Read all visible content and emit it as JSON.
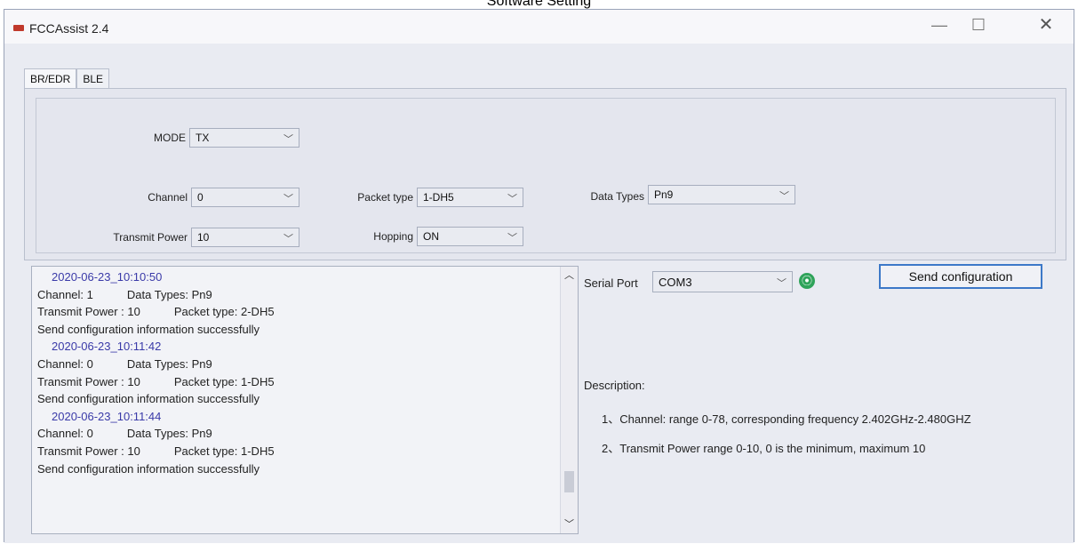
{
  "caption": "Software Setting",
  "window": {
    "title": "FCCAssist 2.4",
    "controls": {
      "minimize": "—",
      "maximize": "☐",
      "close": "✕"
    }
  },
  "tabs": [
    {
      "label": "BR/EDR",
      "active": true
    },
    {
      "label": "BLE",
      "active": false
    }
  ],
  "form": {
    "mode": {
      "label": "MODE",
      "value": "TX"
    },
    "channel": {
      "label": "Channel",
      "value": "0"
    },
    "packet_type": {
      "label": "Packet type",
      "value": "1-DH5"
    },
    "data_types": {
      "label": "Data Types",
      "value": "Pn9"
    },
    "transmit_power": {
      "label": "Transmit Power",
      "value": "10"
    },
    "hopping": {
      "label": "Hopping",
      "value": "ON"
    }
  },
  "log": {
    "lines": [
      {
        "kind": "ts",
        "text": "2020-06-23_10:10:50"
      },
      {
        "kind": "pair",
        "a": "Channel: 1",
        "b": "Data Types: Pn9"
      },
      {
        "kind": "pair",
        "a": "Transmit Power : 10",
        "b": "Packet type: 2-DH5"
      },
      {
        "kind": "text",
        "text": "Send configuration information successfully"
      },
      {
        "kind": "ts",
        "text": "2020-06-23_10:11:42"
      },
      {
        "kind": "pair",
        "a": "Channel: 0",
        "b": "Data Types: Pn9"
      },
      {
        "kind": "pair",
        "a": "Transmit Power : 10",
        "b": "Packet type: 1-DH5"
      },
      {
        "kind": "text",
        "text": "Send configuration information successfully"
      },
      {
        "kind": "ts",
        "text": "2020-06-23_10:11:44"
      },
      {
        "kind": "pair",
        "a": "Channel: 0",
        "b": "Data Types: Pn9"
      },
      {
        "kind": "pair",
        "a": "Transmit Power : 10",
        "b": "Packet type: 1-DH5"
      },
      {
        "kind": "text",
        "text": "Send configuration information successfully"
      }
    ]
  },
  "serial": {
    "label": "Serial Port",
    "value": "COM3"
  },
  "send_button": "Send configuration",
  "description": {
    "title": "Description:",
    "items": [
      "1、Channel: range 0-78, corresponding frequency 2.402GHz-2.480GHZ",
      "2、Transmit Power  range 0-10, 0 is the minimum, maximum 10"
    ]
  },
  "colors": {
    "accent": "#3c78c8",
    "timestamp": "#3a3aa8",
    "connected": "#2fa35a"
  },
  "icons": {
    "connection": "connection-icon",
    "app": "app-icon"
  }
}
